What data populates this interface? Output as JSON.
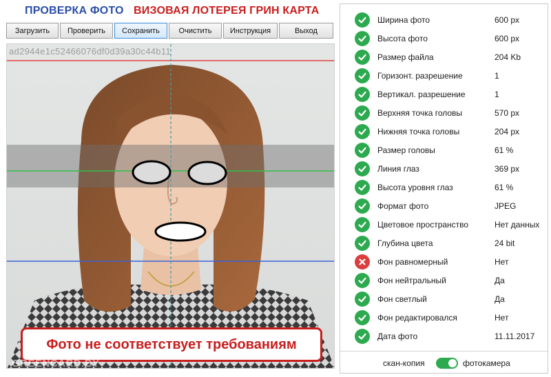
{
  "header": {
    "title_left": "ПРОВЕРКА ФОТО",
    "title_right": "ВИЗОВАЯ ЛОТЕРЕЯ ГРИН КАРТА"
  },
  "toolbar": {
    "buttons": [
      "Загрузить",
      "Проверить",
      "Сохранить",
      "Очистить",
      "Инструкция",
      "Выход"
    ],
    "active": "Сохранить"
  },
  "photo": {
    "hash": "ad2944e1c52466076df0d39a30c44b11",
    "verdict": "Фото не соответствует требованиям",
    "watermark": "GREENCARD.BY"
  },
  "checks": [
    {
      "label": "Ширина фото",
      "value": "600 px",
      "status": "ok"
    },
    {
      "label": "Высота фото",
      "value": "600 px",
      "status": "ok"
    },
    {
      "label": "Размер файла",
      "value": "204 Kb",
      "status": "ok"
    },
    {
      "label": "Горизонт. разрешение",
      "value": "1",
      "status": "ok"
    },
    {
      "label": "Вертикал. разрешение",
      "value": "1",
      "status": "ok"
    },
    {
      "label": "Верхняя точка головы",
      "value": "570 px",
      "status": "ok"
    },
    {
      "label": "Нижняя точка головы",
      "value": "204 px",
      "status": "ok"
    },
    {
      "label": "Размер головы",
      "value": "61 %",
      "status": "ok"
    },
    {
      "label": "Линия глаз",
      "value": "369 px",
      "status": "ok"
    },
    {
      "label": "Высота уровня глаз",
      "value": "61 %",
      "status": "ok"
    },
    {
      "label": "Формат фото",
      "value": "JPEG",
      "status": "ok"
    },
    {
      "label": "Цветовое пространство",
      "value": "Нет данных",
      "status": "ok"
    },
    {
      "label": "Глубина цвета",
      "value": "24 bit",
      "status": "ok"
    },
    {
      "label": "Фон равномерный",
      "value": "Нет",
      "status": "bad"
    },
    {
      "label": "Фон нейтральный",
      "value": "Да",
      "status": "ok"
    },
    {
      "label": "Фон светлый",
      "value": "Да",
      "status": "ok"
    },
    {
      "label": "Фон редактировался",
      "value": "Нет",
      "status": "ok"
    },
    {
      "label": "Дата фото",
      "value": "11.11.2017",
      "status": "ok"
    }
  ],
  "mode": {
    "left_label": "скан-копия",
    "right_label": "фотокамера",
    "selected": "фотокамера"
  },
  "colors": {
    "title_blue": "#2b4ea8",
    "title_red": "#c81e1e",
    "ok_green": "#2daa4f",
    "fail_red": "#dc3d3d",
    "guide_red": "#e04040",
    "guide_green": "#2ec24a",
    "guide_blue": "#3a62d8"
  }
}
